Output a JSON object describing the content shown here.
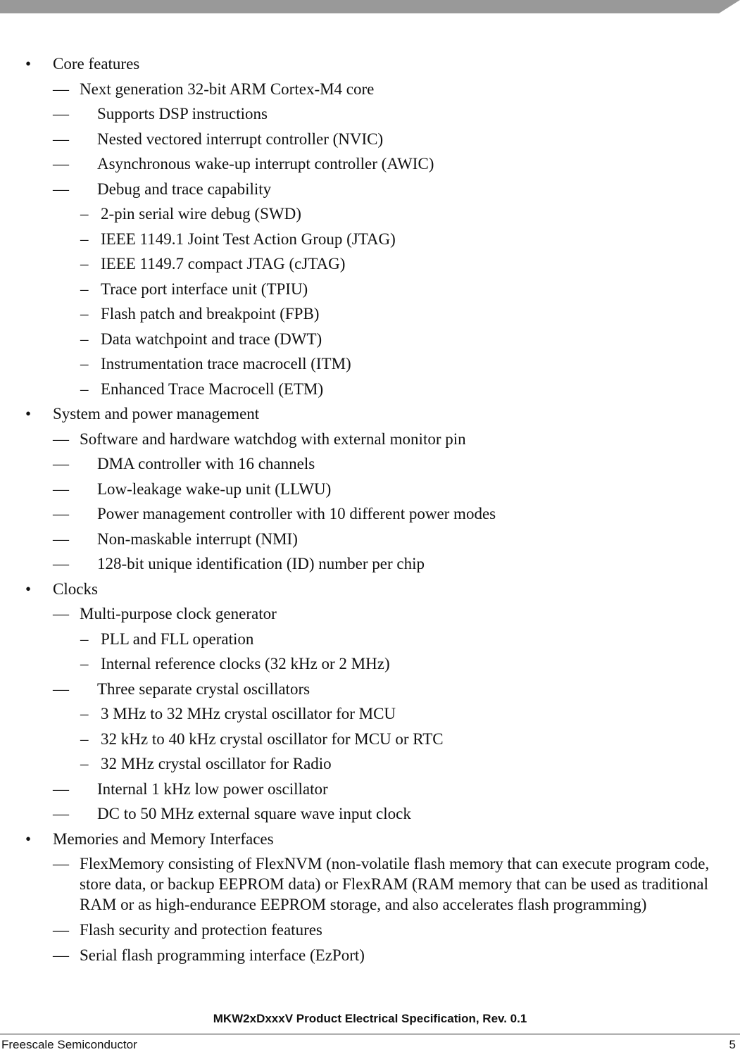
{
  "header": {
    "bar_color": "#999999"
  },
  "markers": {
    "bullet": "•",
    "em_dash": "—",
    "en_dash": "–"
  },
  "sections": [
    {
      "title": "Core features",
      "items": [
        {
          "text": "Next generation 32-bit ARM Cortex-M4 core"
        },
        {
          "text": "Supports DSP instructions"
        },
        {
          "text": "Nested vectored interrupt controller (NVIC)"
        },
        {
          "text": "Asynchronous wake-up interrupt controller (AWIC)"
        },
        {
          "text": "Debug and trace capability",
          "subitems": [
            "2-pin serial wire debug (SWD)",
            "IEEE 1149.1 Joint Test Action Group (JTAG)",
            "IEEE 1149.7 compact JTAG (cJTAG)",
            "Trace port interface unit (TPIU)",
            "Flash patch and breakpoint (FPB)",
            "Data watchpoint and trace (DWT)",
            "Instrumentation trace macrocell (ITM)",
            "Enhanced Trace Macrocell (ETM)"
          ]
        }
      ]
    },
    {
      "title": "System and power management",
      "items": [
        {
          "text": "Software and hardware watchdog with external monitor pin"
        },
        {
          "text": "DMA controller with 16 channels"
        },
        {
          "text": "Low-leakage wake-up unit (LLWU)"
        },
        {
          "text": "Power management controller with 10 different power modes"
        },
        {
          "text": "Non-maskable interrupt (NMI)"
        },
        {
          "text": "128-bit unique identification (ID) number per chip"
        }
      ]
    },
    {
      "title": "Clocks",
      "items": [
        {
          "text": "Multi-purpose clock generator",
          "subitems": [
            "PLL and FLL operation",
            "Internal reference clocks (32 kHz or 2 MHz)"
          ]
        },
        {
          "text": "Three separate crystal oscillators",
          "subitems": [
            "3 MHz to 32 MHz crystal oscillator for MCU",
            "32 kHz to 40 kHz crystal oscillator for MCU or RTC",
            "32 MHz crystal oscillator for Radio"
          ]
        },
        {
          "text": "Internal 1 kHz low power oscillator"
        },
        {
          "text": "DC to 50 MHz external square wave input clock"
        }
      ]
    },
    {
      "title": "Memories and Memory Interfaces",
      "items": [
        {
          "text": "FlexMemory consisting of FlexNVM (non-volatile flash memory that can execute program code, store data, or backup EEPROM data) or FlexRAM (RAM memory that can be used as traditional RAM or as high-endurance EEPROM storage, and also accelerates flash programming)"
        },
        {
          "text": "Flash security and protection features"
        },
        {
          "text": "Serial flash programming interface (EzPort)"
        }
      ]
    }
  ],
  "footer": {
    "document_title": "MKW2xDxxxV Product Electrical Specification, Rev. 0.1",
    "company": "Freescale Semiconductor",
    "page_number": "5"
  }
}
